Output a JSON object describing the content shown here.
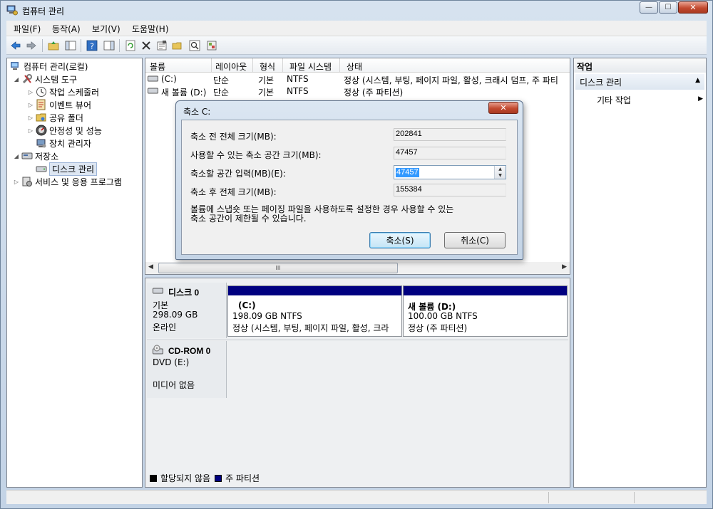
{
  "window": {
    "title": "컴퓨터 관리",
    "controls": {
      "minimize": "—",
      "maximize": "☐",
      "close": "✕"
    }
  },
  "menu": [
    "파일(F)",
    "동작(A)",
    "보기(V)",
    "도움말(H)"
  ],
  "toolbar_icons": [
    "back-icon",
    "forward-icon",
    "up-icon",
    "show-tree-icon",
    "help-icon",
    "view-icon",
    "refresh-icon",
    "delete-icon",
    "properties-icon",
    "open-icon",
    "search-icon",
    "settings-icon"
  ],
  "tree": {
    "root": "컴퓨터 관리(로컬)",
    "system_tools": "시스템 도구",
    "task_scheduler": "작업 스케줄러",
    "event_viewer": "이벤트 뷰어",
    "shared_folders": "공유 폴더",
    "reliability": "안정성 및 성능",
    "device_manager": "장치 관리자",
    "storage": "저장소",
    "disk_management": "디스크 관리",
    "services": "서비스 및 응용 프로그램"
  },
  "volume_list": {
    "columns": [
      "볼륨",
      "레이아웃",
      "형식",
      "파일 시스템",
      "상태"
    ],
    "rows": [
      {
        "volume": "(C:)",
        "layout": "단순",
        "type": "기본",
        "fs": "NTFS",
        "status": "정상 (시스템, 부팅, 페이지 파일, 활성, 크래시 덤프, 주 파티"
      },
      {
        "volume": "새 볼륨 (D:)",
        "layout": "단순",
        "type": "기본",
        "fs": "NTFS",
        "status": "정상 (주 파티션)"
      }
    ],
    "scroll_thumb": "III"
  },
  "disks": {
    "disk0": {
      "name": "디스크 0",
      "type": "기본",
      "size": "298.09 GB",
      "state": "온라인",
      "partitions": [
        {
          "name": "(C:)",
          "size": "198.09 GB NTFS",
          "status": "정상 (시스템, 부팅, 페이지 파일, 활성, 크라"
        },
        {
          "name": "새 볼륨  (D:)",
          "size": "100.00 GB NTFS",
          "status": "정상 (주 파티션)"
        }
      ]
    },
    "cdrom0": {
      "name": "CD-ROM 0",
      "drive": "DVD (E:)",
      "media": "미디어 없음"
    }
  },
  "legend": {
    "unallocated": "할당되지 않음",
    "primary": "주 파티션",
    "colors": {
      "unallocated": "#000000",
      "primary": "#000080"
    }
  },
  "actions": {
    "header": "작업",
    "section": "디스크 관리",
    "section_arrow": "▲",
    "item": "기타 작업",
    "item_arrow": "▶"
  },
  "dialog": {
    "title": "축소 C:",
    "close": "✕",
    "total_before_label": "축소 전 전체 크기(MB):",
    "total_before_value": "202841",
    "available_label": "사용할 수 있는 축소 공간 크기(MB):",
    "available_value": "47457",
    "shrink_label": "축소할 공간 입력(MB)(E):",
    "shrink_value": "47457",
    "total_after_label": "축소 후 전체 크기(MB):",
    "total_after_value": "155384",
    "note_line1": "볼륨에 스냅숏 또는 페이징 파일을 사용하도록 설정한 경우 사용할 수 있는",
    "note_line2": "축소 공간이 제한될 수 있습니다.",
    "shrink_button": "축소(S)",
    "cancel_button": "취소(C)"
  }
}
